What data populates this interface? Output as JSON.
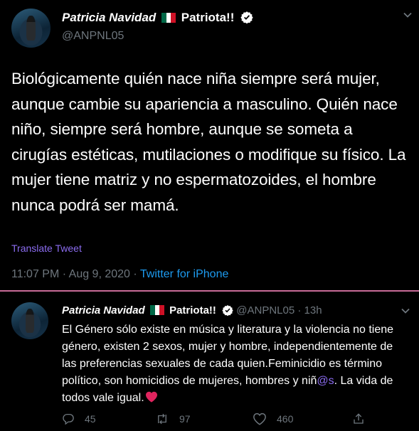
{
  "tweet": {
    "author_name": "Patricia Navidad",
    "author_tag": "Patriota!!",
    "handle": "@ANPNL05",
    "text": "Biológicamente quién nace niña siempre será mujer, aunque cambie su apariencia a masculino. Quién nace niño, siempre será hombre, aunque se someta a cirugías estéticas, mutilaciones o modifique su físico. La mujer tiene matriz y no espermatozoides, el hombre nunca podrá ser mamá.",
    "translate_label": "Translate Tweet",
    "time": "11:07 PM",
    "date": "Aug 9, 2020",
    "separator": "·",
    "source": "Twitter for iPhone"
  },
  "reply": {
    "author_name": "Patricia Navidad",
    "author_tag": "Patriota!!",
    "handle": "@ANPNL05",
    "separator": "·",
    "age": "13h",
    "text_before": "El Género sólo existe en música y literatura y la violencia no tiene género,  existen 2 sexos, mujer y hombre, independientemente de las preferencias sexuales de cada quien.Feminicidio es término político, son homicidios de mujeres, hombres y niñ",
    "mention": "@s",
    "text_after": ". La vida de todos vale igual.",
    "reply_count": "45",
    "retweet_count": "97",
    "like_count": "460"
  },
  "colors": {
    "background": "#000000",
    "link": "#1d9bf0",
    "purple_link": "#8b6cf0",
    "muted": "#6e767d",
    "divider": "#c76a97",
    "heart": "#e0245e"
  },
  "icons": [
    "verified-badge-icon",
    "mexico-flag-icon",
    "chevron-down-icon",
    "reply-icon",
    "retweet-icon",
    "like-icon",
    "share-icon",
    "red-heart-emoji"
  ]
}
